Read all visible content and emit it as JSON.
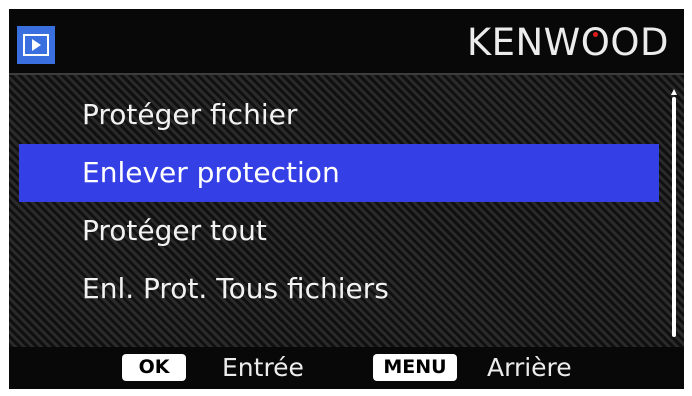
{
  "header": {
    "mode_icon": "playback-icon",
    "brand_prefix": "KENW",
    "brand_o": "O",
    "brand_suffix": "OD"
  },
  "menu": {
    "items": [
      {
        "label": "Protéger fichier",
        "selected": false
      },
      {
        "label": "Enlever protection",
        "selected": true
      },
      {
        "label": "Protéger tout",
        "selected": false
      },
      {
        "label": "Enl. Prot. Tous fichiers",
        "selected": false
      }
    ]
  },
  "footer": {
    "ok_key": "OK",
    "ok_action": "Entrée",
    "menu_key": "MENU",
    "menu_action": "Arrière"
  },
  "colors": {
    "selection": "#3440e6",
    "icon_blue": "#3a6fe0",
    "brand_dot": "#e01c1c",
    "background": "#161616"
  }
}
